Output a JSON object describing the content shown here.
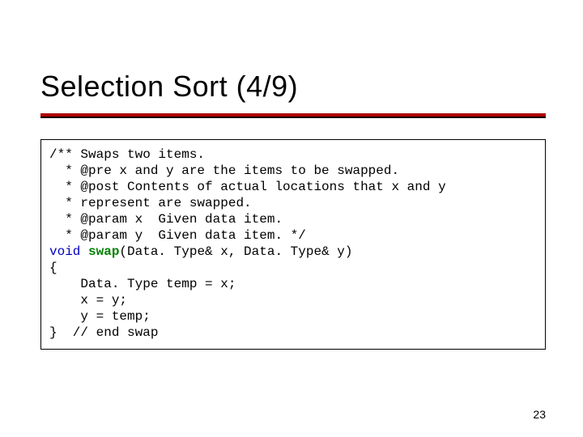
{
  "title": "Selection Sort (4/9)",
  "page_number": "23",
  "code": {
    "l1": "/** Swaps two items.",
    "l2": "  * @pre x and y are the items to be swapped.",
    "l3": "  * @post Contents of actual locations that x and y",
    "l4": "  * represent are swapped.",
    "l5": "  * @param x  Given data item.",
    "l6": "  * @param y  Given data item. */",
    "l7_void": "void",
    "l7_space": " ",
    "l7_swap": "swap",
    "l7_rest": "(Data. Type& x, Data. Type& y)",
    "l8": "{",
    "l9": "    Data. Type temp = x;",
    "l10": "    x = y;",
    "l11": "    y = temp;",
    "l12": "}  // end swap"
  }
}
